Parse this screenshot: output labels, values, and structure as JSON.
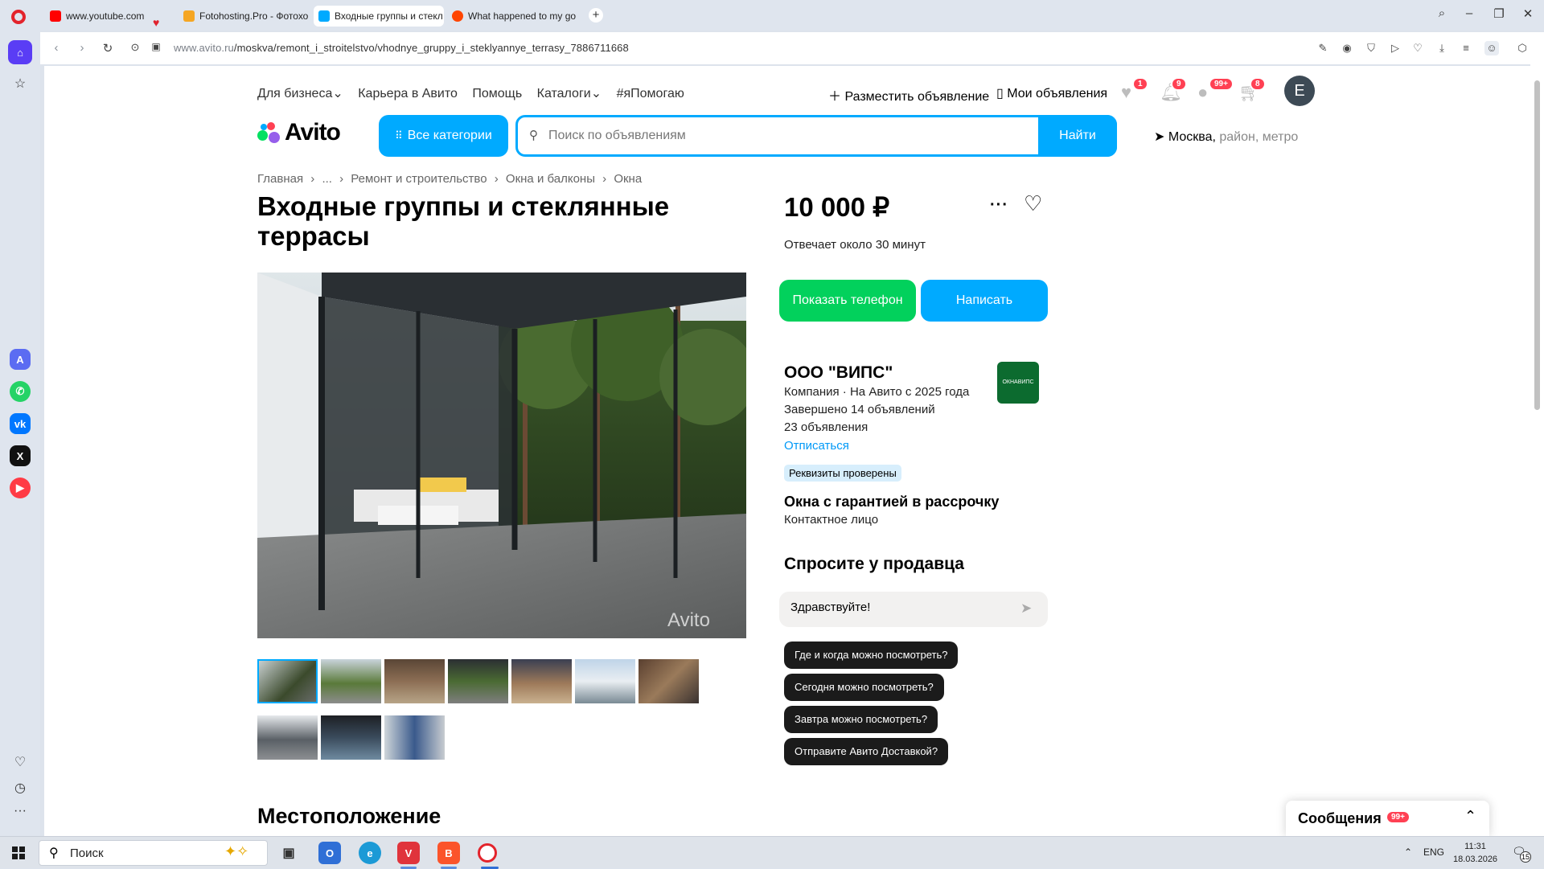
{
  "browser": {
    "tabs": [
      {
        "title": "www.youtube.com",
        "fav_color": "#ff0000"
      },
      {
        "title": "Fotohosting.Pro - Фотохо",
        "fav_color": "#f5a623"
      },
      {
        "title": "Входные группы и стекл",
        "fav_color": "#00aaff"
      },
      {
        "title": "What happened to my go",
        "fav_color": "#ff4500"
      }
    ],
    "url_host": "www.avito.ru",
    "url_path": "/moskva/remont_i_stroitelstvo/vhodnye_gruppy_i_steklyannye_terrasy_7886711668"
  },
  "sidebar": {
    "apps": [
      {
        "name": "aria",
        "color": "#5b6cf2"
      },
      {
        "name": "whatsapp",
        "color": "#25d366"
      },
      {
        "name": "vk",
        "color": "#0077ff"
      },
      {
        "name": "x",
        "color": "#111111"
      },
      {
        "name": "music",
        "color": "#ff3b45"
      }
    ]
  },
  "header": {
    "nav": [
      "Для бизнеса",
      "Карьера в Авито",
      "Помощь",
      "Каталоги",
      "#яПомогаю"
    ],
    "post_ad": "Разместить объявление",
    "my_ads": "Мои объявления",
    "badges": {
      "favorites": "1",
      "notifications": "9",
      "messages": "99+",
      "cart": "8"
    },
    "avatar_letter": "E",
    "logo_text": "Avito",
    "all_categories": "Все категории",
    "search_placeholder": "Поиск по объявлениям",
    "find_button": "Найти",
    "location_city": "Москва,",
    "location_rest": " район, метро"
  },
  "breadcrumb": [
    "Главная",
    "›",
    "...",
    "›",
    "Ремонт и строительство",
    "›",
    "Окна и балконы",
    "›",
    "Окна"
  ],
  "listing": {
    "title": "Входные группы и стеклянные террасы",
    "watermark": "Avito",
    "price": "10 000 ₽",
    "responds": "Отвечает около 30 минут",
    "show_phone": "Показать телефон",
    "write": "Написать"
  },
  "seller": {
    "name": "ООО \"ВИПС\"",
    "meta": "Компания · На Авито с 2025 года",
    "completed": "Завершено 14 объявлений",
    "ads_count": "23 объявления",
    "unsubscribe": "Отписаться",
    "logo_text": "ОКНАВИПС",
    "verified": "Реквизиты проверены",
    "offer_title": "Окна с гарантией в рассрочку",
    "contact": "Контактное лицо"
  },
  "ask": {
    "title": "Спросите у продавца",
    "message_value": "Здравствуйте!",
    "chips": [
      "Где и когда можно посмотреть?",
      "Сегодня можно посмотреть?",
      "Завтра можно посмотреть?",
      "Отправите Авито Доставкой?"
    ]
  },
  "location_section": "Местоположение",
  "messages_panel": {
    "label": "Сообщения",
    "badge": "99+"
  },
  "taskbar": {
    "search": "Поиск",
    "lang": "ENG",
    "time": "11:31",
    "date": "18.03.2026",
    "notif_count": "15"
  },
  "colors": {
    "accent": "#00aaff",
    "green": "#02d15c",
    "badge": "#ff4053"
  }
}
